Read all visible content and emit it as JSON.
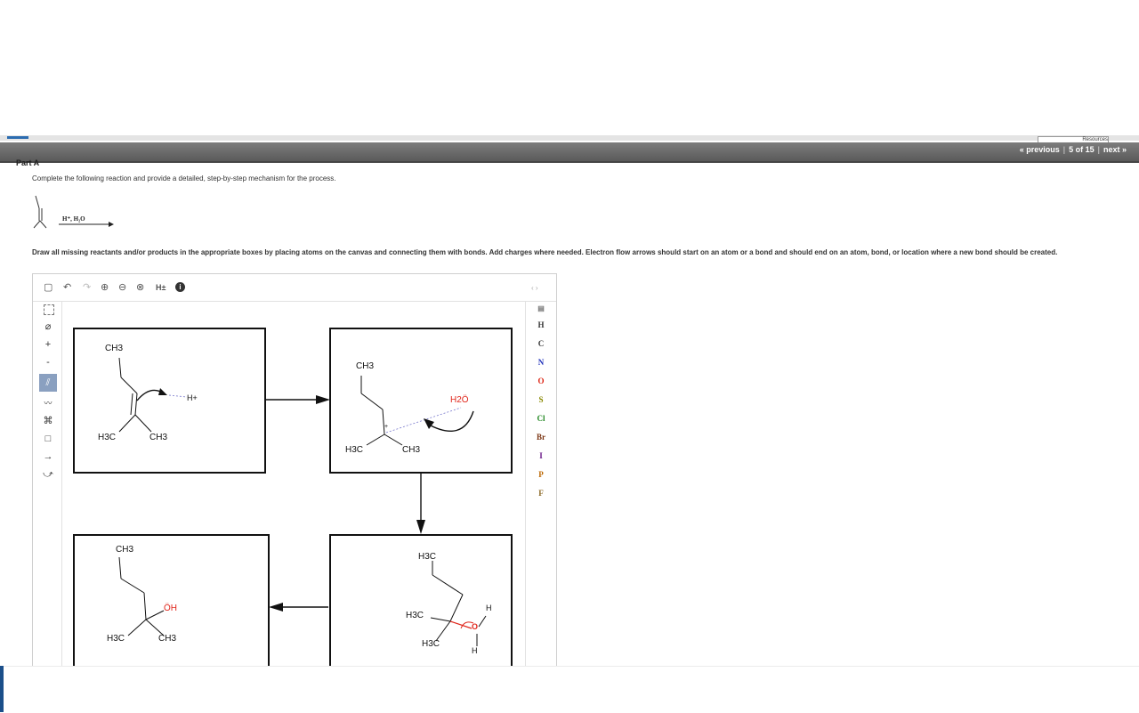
{
  "header": {
    "resources_label": "Resources",
    "nav": {
      "previous": "« previous",
      "position": "5 of 15",
      "next": "next »"
    }
  },
  "part": {
    "label": "Part A"
  },
  "question": {
    "prompt": "Complete the following reaction and provide a detailed, step-by-step mechanism for the process.",
    "reagents": "H⁺, H₂O",
    "instructions": "Draw all missing reactants and/or products in the appropriate boxes by placing atoms on the canvas and connecting them with bonds. Add charges where needed. Electron flow arrows should start on an atom or a bond and should end on an atom, bond, or location where a new bond should be created."
  },
  "sketcher": {
    "toolbar": {
      "new": "new-document-icon",
      "undo": "undo-icon",
      "redo": "redo-icon",
      "zoom_in": "zoom-in-icon",
      "zoom_out": "zoom-out-icon",
      "zoom_reset": "zoom-reset-icon",
      "hydrogen_toggle": "H±",
      "info": "info-icon",
      "expand": "‹ ›"
    },
    "left_tools": [
      {
        "name": "select-tool",
        "icon": "selection-icon"
      },
      {
        "name": "erase-tool",
        "icon": "eraser-icon"
      },
      {
        "name": "plus-charge-tool",
        "symbol": "+"
      },
      {
        "name": "minus-charge-tool",
        "symbol": "-"
      },
      {
        "name": "bond-tool",
        "icon": "bond-icon",
        "active": true
      },
      {
        "name": "chain-tool",
        "icon": "chain-icon"
      },
      {
        "name": "template-tool",
        "icon": "template-icon"
      },
      {
        "name": "box-tool",
        "icon": "box-icon"
      },
      {
        "name": "arrow-tool",
        "icon": "arrow-icon"
      },
      {
        "name": "electron-flow-tool",
        "icon": "curved-arrow-icon"
      }
    ],
    "atoms": [
      {
        "symbol": "H",
        "color": "#333333"
      },
      {
        "symbol": "C",
        "color": "#333333"
      },
      {
        "symbol": "N",
        "color": "#2233bb"
      },
      {
        "symbol": "O",
        "color": "#dd2211"
      },
      {
        "symbol": "S",
        "color": "#888800"
      },
      {
        "symbol": "Cl",
        "color": "#228822"
      },
      {
        "symbol": "Br",
        "color": "#7a3311"
      },
      {
        "symbol": "I",
        "color": "#6a1a88"
      },
      {
        "symbol": "P",
        "color": "#bb6600"
      },
      {
        "symbol": "F",
        "color": "#886622"
      }
    ],
    "boxes": {
      "box1": {
        "ch3_top": "CH3",
        "h3c_left": "H3C",
        "ch3_right": "CH3",
        "proton": "H+"
      },
      "box2": {
        "ch3_top": "CH3",
        "h3c_left": "H3C",
        "ch3_right": "CH3",
        "water": "H2Ö",
        "cation_charge": "+"
      },
      "box3": {
        "h3c_top": "H3C",
        "h3c_mid": "H3C",
        "h3c_bottom": "H3C",
        "h_top": "H",
        "h_bottom": "H",
        "oxygen": "O"
      },
      "box4": {
        "ch3_top": "CH3",
        "oh": "ÖH",
        "h3c_left": "H3C",
        "ch3_right": "CH3"
      }
    }
  }
}
